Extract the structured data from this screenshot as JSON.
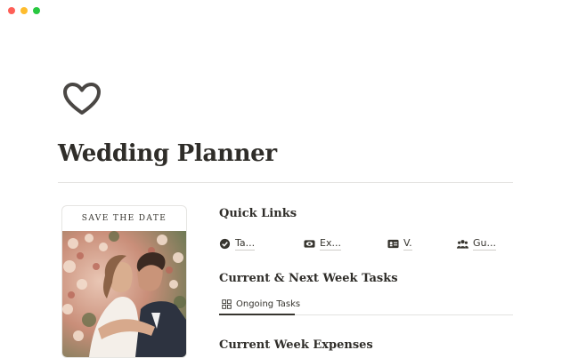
{
  "window": {
    "controls": [
      "close",
      "minimize",
      "maximize"
    ]
  },
  "page": {
    "icon": "heart-outline-icon",
    "title": "Wedding Planner"
  },
  "save_the_date_card": {
    "caption": "SAVE THE DATE",
    "photo": "wedding-couple-kissing-photo"
  },
  "quick_links": {
    "title": "Quick Links",
    "items": [
      {
        "label": "Ta...",
        "icon": "checkmark-badge-icon"
      },
      {
        "label": "Ex...",
        "icon": "money-eye-icon"
      },
      {
        "label": "V.",
        "icon": "vendor-card-icon"
      },
      {
        "label": "Gu...",
        "icon": "people-group-icon"
      }
    ]
  },
  "tasks": {
    "title": "Current & Next Week Tasks",
    "tabs": [
      {
        "label": "Ongoing Tasks",
        "icon": "gallery-grid-icon",
        "active": true
      }
    ]
  },
  "expenses": {
    "title": "Current Week Expenses"
  },
  "colors": {
    "text": "#37352f",
    "divider": "#e3e2e0",
    "close": "#fe5f57",
    "minimize": "#febc2e",
    "maximize": "#28c840"
  }
}
